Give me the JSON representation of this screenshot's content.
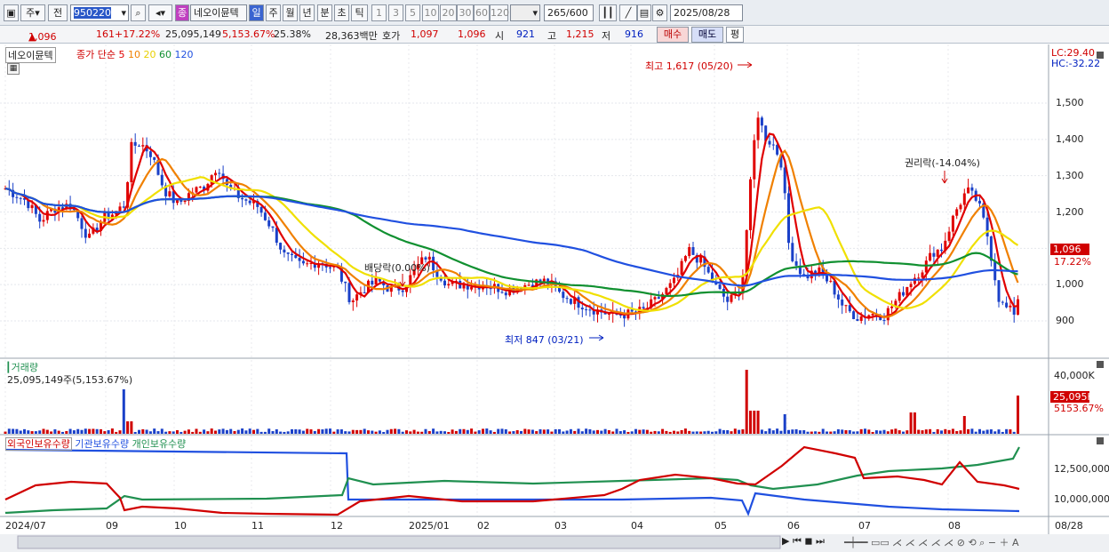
{
  "toolbar": {
    "type_select": "주",
    "prev_label": "전",
    "stock_code": "950220",
    "stock_name": "네오이뮨텍",
    "period_tabs": [
      "일",
      "주",
      "월",
      "년",
      "분",
      "초",
      "틱"
    ],
    "interval_buttons": [
      "1",
      "3",
      "5",
      "10",
      "20",
      "30",
      "60",
      "120"
    ],
    "bar_count": "265",
    "bar_total": "/600",
    "date": "2025/08/28"
  },
  "quote": {
    "price": "1,096",
    "change_symbol": "▲",
    "change": "161",
    "change_pct": "+17.22%",
    "volume": "25,095,149",
    "volume_ratio": "5,153.67%",
    "turnover": "25.38%",
    "amount": "28,363백만",
    "ask_label": "호가",
    "ask1": "1,097",
    "ask2": "1,096",
    "open_label": "시",
    "open": "921",
    "high_label": "고",
    "high": "1,215",
    "low_label": "저",
    "low": "916",
    "buy_label": "매수",
    "sell_label": "매도",
    "avg_label": "평"
  },
  "price_panel": {
    "legend_name": "네오이뮨텍",
    "legend_type": "종가 단순",
    "ma_labels": [
      "5",
      "10",
      "20",
      "60",
      "120"
    ],
    "ma_colors": [
      "#e00000",
      "#f08000",
      "#f0e000",
      "#109030",
      "#2050e0"
    ],
    "lc_label": "LC:29.40",
    "hc_label": "HC:-32.22",
    "y_ticks": [
      "1,500",
      "1,400",
      "1,300",
      "1,200",
      "1,100",
      "1,000",
      "900"
    ],
    "price_tag": "1,096",
    "pct_tag": "17.22%",
    "annotations": {
      "high": "최고 1,617 (05/20)",
      "low": "최저 847 (03/21)",
      "rights": "권리락(-14.04%)",
      "dividend": "배당락(0.00%)"
    }
  },
  "volume_panel": {
    "title": "거래량",
    "summary": "25,095,149주(5,153.67%)",
    "y_ticks": [
      "40,000K"
    ],
    "vol_tag": "25,095K",
    "pct_tag": "5153.67%"
  },
  "holdings_panel": {
    "legend": [
      "외국인보유수량",
      "기관보유수량",
      "개인보유수량"
    ],
    "colors": [
      "#d00000",
      "#2050e0",
      "#209050"
    ],
    "y_ticks": [
      "12,500,000",
      "10,000,000"
    ]
  },
  "x_axis": {
    "labels": [
      "2024/07",
      "09",
      "10",
      "11",
      "12",
      "2025/01",
      "02",
      "03",
      "04",
      "05",
      "06",
      "07",
      "08",
      "08/28"
    ]
  },
  "chart_data": {
    "type": "line",
    "price_range": [
      820,
      1640
    ],
    "candles_hint": "daily candlestick with MA5/10/20/60/120"
  }
}
